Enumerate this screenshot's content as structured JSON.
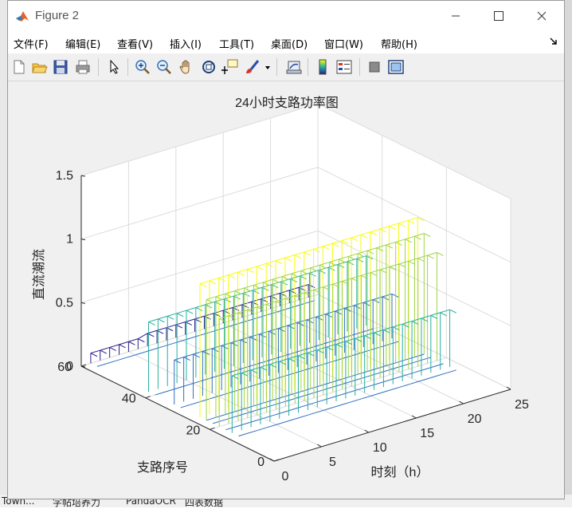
{
  "window": {
    "title": "Figure 2"
  },
  "menu": [
    {
      "label": "文件(F)"
    },
    {
      "label": "编辑(E)"
    },
    {
      "label": "查看(V)"
    },
    {
      "label": "插入(I)"
    },
    {
      "label": "工具(T)"
    },
    {
      "label": "桌面(D)"
    },
    {
      "label": "窗口(W)"
    },
    {
      "label": "帮助(H)"
    }
  ],
  "toolbar": {
    "icons": [
      "new-figure-icon",
      "open-file-icon",
      "save-icon",
      "print-icon",
      "select-arrow-icon",
      "zoom-in-icon",
      "zoom-out-icon",
      "pan-hand-icon",
      "rotate-3d-icon",
      "data-cursor-icon",
      "brush-icon",
      "brush-dropdown-icon",
      "link-plot-icon",
      "insert-colorbar-icon",
      "insert-legend-icon",
      "hide-plot-tools-icon",
      "show-plot-tools-icon"
    ]
  },
  "taskbar_fragments": [
    "Town...",
    "字帖培养力",
    "PandaOCR",
    "四表数据"
  ],
  "chart_data": {
    "type": "surface3d",
    "title": "24小时支路功率图",
    "xlabel": "时刻（h）",
    "ylabel": "支路序号",
    "zlabel": "直流潮流",
    "xlim": [
      0,
      25
    ],
    "ylim": [
      0,
      60
    ],
    "zlim": [
      0,
      1.5
    ],
    "xticks": [
      "0",
      "5",
      "10",
      "15",
      "20",
      "25"
    ],
    "yticks": [
      "0",
      "20",
      "40",
      "60"
    ],
    "zticks": [
      "0",
      "0.5",
      "1",
      "1.5"
    ],
    "grid": true,
    "colormap": [
      "#2a1f8c",
      "#2d6fc2",
      "#25b0a0",
      "#9fd448",
      "#f9fb0e"
    ],
    "hours": 24,
    "branches": [
      {
        "branch": 60,
        "values": [
          0.08,
          0.08,
          0.08,
          0.08,
          0.08,
          0.08,
          0.1,
          0.1,
          0.1,
          0.1,
          0.1,
          0.1,
          0.1,
          0.1,
          0.1,
          0.1,
          0.1,
          0.1,
          0.1,
          0.1,
          0.1,
          0.1,
          0.1,
          0.1
        ]
      },
      {
        "branch": 42,
        "values": [
          0.55,
          0.55,
          0.55,
          0.55,
          0.55,
          0.55,
          0.55,
          0.55,
          0.55,
          0.55,
          0.55,
          0.55,
          0.55,
          0.55,
          0.55,
          0.55,
          0.55,
          0.55,
          0.55,
          0.55,
          0.55,
          0.55,
          0.55,
          0.55
        ]
      },
      {
        "branch": 34,
        "values": [
          0.35,
          0.35,
          0.35,
          0.35,
          0.35,
          0.35,
          0.35,
          0.35,
          0.35,
          0.35,
          0.35,
          0.35,
          0.35,
          0.35,
          0.35,
          0.35,
          0.35,
          0.35,
          0.35,
          0.35,
          0.35,
          0.35,
          0.35,
          0.35
        ]
      },
      {
        "branch": 26,
        "values": [
          1.05,
          1.05,
          1.05,
          1.05,
          1.05,
          1.05,
          1.05,
          1.05,
          1.05,
          1.05,
          1.05,
          1.05,
          1.05,
          1.05,
          1.05,
          1.05,
          1.05,
          1.05,
          1.05,
          1.05,
          1.05,
          1.05,
          1.05,
          1.05
        ]
      },
      {
        "branch": 24,
        "values": [
          0.95,
          0.95,
          0.95,
          0.95,
          0.95,
          0.95,
          0.95,
          0.95,
          0.95,
          0.95,
          0.95,
          0.95,
          0.95,
          0.95,
          0.95,
          0.95,
          0.95,
          0.95,
          0.95,
          0.95,
          0.95,
          0.95,
          0.95,
          0.95
        ]
      },
      {
        "branch": 20,
        "values": [
          0.85,
          0.85,
          0.85,
          0.85,
          0.85,
          0.85,
          0.85,
          0.85,
          0.85,
          0.85,
          0.85,
          0.85,
          0.85,
          0.85,
          0.85,
          0.85,
          0.85,
          0.85,
          0.85,
          0.85,
          0.85,
          0.85,
          0.85,
          0.85
        ]
      },
      {
        "branch": 16,
        "values": [
          0.45,
          0.45,
          0.45,
          0.45,
          0.45,
          0.45,
          0.45,
          0.45,
          0.45,
          0.45,
          0.45,
          0.45,
          0.45,
          0.45,
          0.45,
          0.45,
          0.45,
          0.45,
          0.45,
          0.45,
          0.45,
          0.45,
          0.45,
          0.45
        ]
      }
    ]
  }
}
